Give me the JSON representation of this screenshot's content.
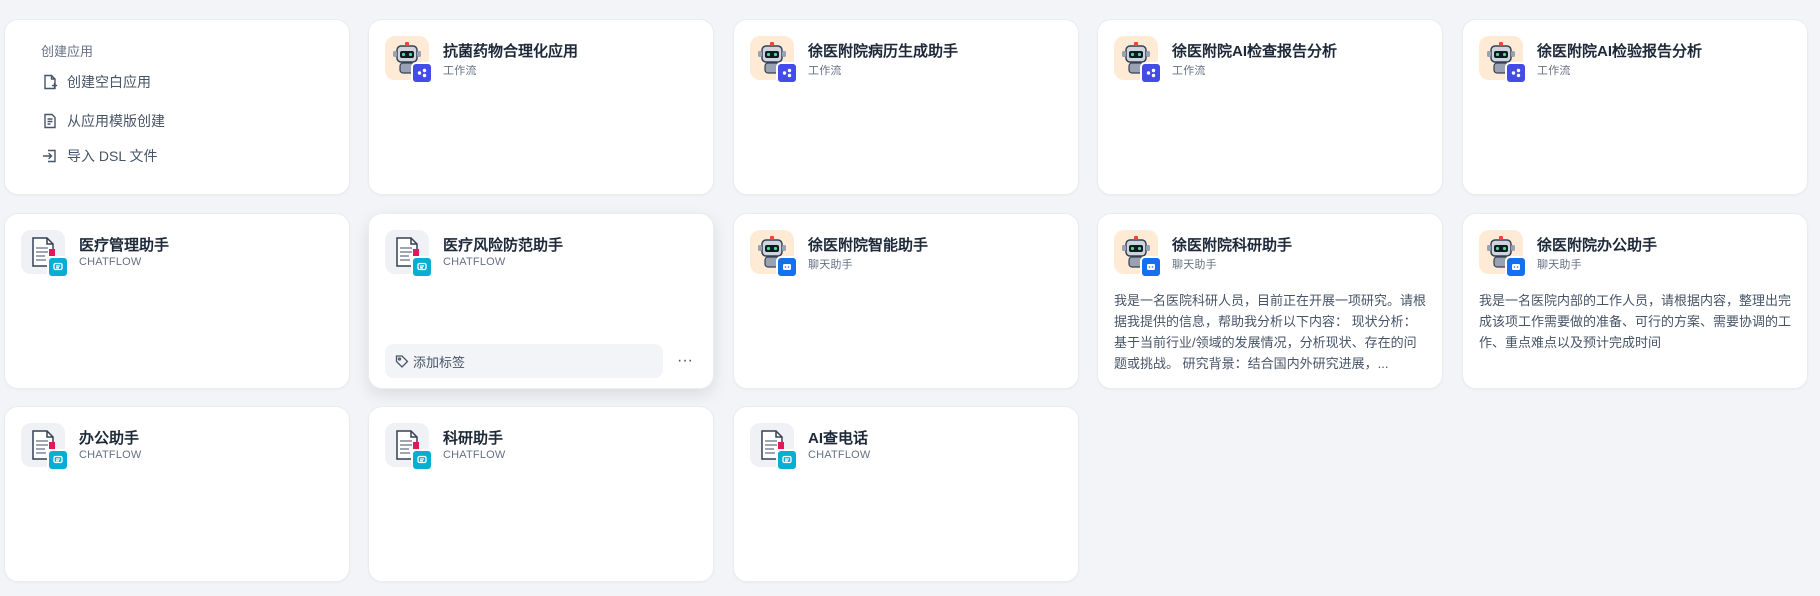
{
  "create": {
    "title": "创建应用",
    "items": [
      {
        "label": "创建空白应用",
        "icon": "file-plus-icon"
      },
      {
        "label": "从应用模版创建",
        "icon": "template-icon"
      },
      {
        "label": "导入 DSL 文件",
        "icon": "import-icon"
      }
    ]
  },
  "apps": [
    {
      "name": "抗菌药物合理化应用",
      "type": "工作流",
      "icon": "robot-icon",
      "badge": "workflow-badge-icon"
    },
    {
      "name": "徐医附院病历生成助手",
      "type": "工作流",
      "icon": "robot-icon",
      "badge": "workflow-badge-icon"
    },
    {
      "name": "徐医附院AI检查报告分析",
      "type": "工作流",
      "icon": "robot-icon",
      "badge": "workflow-badge-icon"
    },
    {
      "name": "徐医附院AI检验报告分析",
      "type": "工作流",
      "icon": "robot-icon",
      "badge": "workflow-badge-icon"
    },
    {
      "name": "医疗管理助手",
      "type": "CHATFLOW",
      "icon": "document-icon",
      "badge": "chatflow-badge-icon"
    },
    {
      "name": "医疗风险防范助手",
      "type": "CHATFLOW",
      "icon": "document-icon",
      "badge": "chatflow-badge-icon"
    },
    {
      "name": "徐医附院智能助手",
      "type": "聊天助手",
      "icon": "robot-icon",
      "badge": "chat-badge-icon"
    },
    {
      "name": "徐医附院科研助手",
      "type": "聊天助手",
      "icon": "robot-icon",
      "badge": "chat-badge-icon",
      "desc": "我是一名医院科研人员，目前正在开展一项研究。请根据我提供的信息，帮助我分析以下内容： 现状分析：基于当前行业/领域的发展情况，分析现状、存在的问题或挑战。 研究背景：结合国内外研究进展，..."
    },
    {
      "name": "徐医附院办公助手",
      "type": "聊天助手",
      "icon": "robot-icon",
      "badge": "chat-badge-icon",
      "desc": "我是一名医院内部的工作人员，请根据内容，整理出完成该项工作需要做的准备、可行的方案、需要协调的工作、重点难点以及预计完成时间"
    },
    {
      "name": "办公助手",
      "type": "CHATFLOW",
      "icon": "document-icon",
      "badge": "chatflow-badge-icon"
    },
    {
      "name": "科研助手",
      "type": "CHATFLOW",
      "icon": "document-icon",
      "badge": "chatflow-badge-icon"
    },
    {
      "name": "AI查电话",
      "type": "CHATFLOW",
      "icon": "document-icon",
      "badge": "chatflow-badge-icon"
    }
  ],
  "hover_card": {
    "tag_label": "添加标签",
    "more_label": "···"
  },
  "colors": {
    "workflow_badge": "#444ce7",
    "chat_badge": "#1570ef",
    "chatflow_badge": "#06aed4",
    "robot_bg": "#ffead5",
    "doc_bg": "#eff1f5"
  }
}
